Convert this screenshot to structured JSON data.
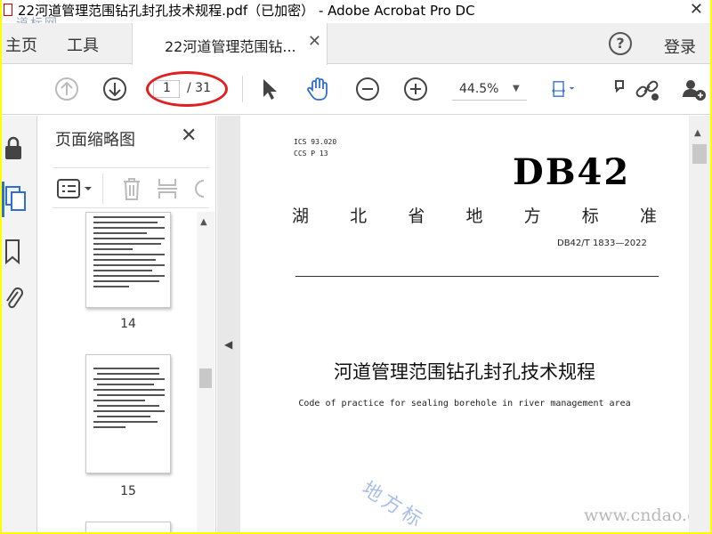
{
  "window": {
    "title": "22河道管理范围钻孔封孔技术规程.pdf（已加密） - Adobe Acrobat Pro DC",
    "close_glyph": "✕",
    "watermark": "道标网"
  },
  "tabs": {
    "home": "主页",
    "tools": "工具",
    "document": "22河道管理范围钻...",
    "document_close": "✕"
  },
  "header_right": {
    "help": "?",
    "login": "登录"
  },
  "toolbar": {
    "current_page": "1",
    "total_pages": "/ 31",
    "zoom": "44.5%",
    "zoom_caret": "▼",
    "annotation_color": "#e02020"
  },
  "thumbnail_panel": {
    "title": "页面缩略图",
    "close": "✕",
    "thumbnails": [
      {
        "page": "14"
      },
      {
        "page": "15"
      }
    ]
  },
  "document": {
    "ics": "ICS  93.020",
    "ccs": "CCS  P 13",
    "db_code": "DB42",
    "standard_type_chars": [
      "湖",
      "北",
      "省",
      "地",
      "方",
      "标",
      "准"
    ],
    "standard_no": "DB42/T 1833—2022",
    "title": "河道管理范围钻孔封孔技术规程",
    "subtitle": "Code of practice for sealing borehole in river management area",
    "watermark_diagonal": "地方标",
    "watermark_site": "www.cndao.com"
  },
  "colors": {
    "frame": "#ffff00",
    "accent": "#2f6fd1",
    "icon": "#555555"
  }
}
